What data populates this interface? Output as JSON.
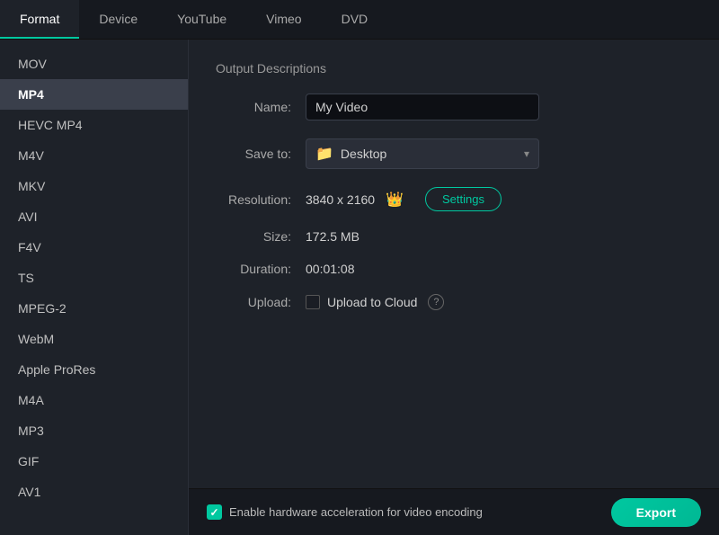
{
  "tabs": [
    {
      "id": "format",
      "label": "Format",
      "active": true
    },
    {
      "id": "device",
      "label": "Device",
      "active": false
    },
    {
      "id": "youtube",
      "label": "YouTube",
      "active": false
    },
    {
      "id": "vimeo",
      "label": "Vimeo",
      "active": false
    },
    {
      "id": "dvd",
      "label": "DVD",
      "active": false
    }
  ],
  "sidebar": {
    "items": [
      {
        "id": "mov",
        "label": "MOV",
        "selected": false
      },
      {
        "id": "mp4",
        "label": "MP4",
        "selected": true
      },
      {
        "id": "hevc-mp4",
        "label": "HEVC MP4",
        "selected": false
      },
      {
        "id": "m4v",
        "label": "M4V",
        "selected": false
      },
      {
        "id": "mkv",
        "label": "MKV",
        "selected": false
      },
      {
        "id": "avi",
        "label": "AVI",
        "selected": false
      },
      {
        "id": "f4v",
        "label": "F4V",
        "selected": false
      },
      {
        "id": "ts",
        "label": "TS",
        "selected": false
      },
      {
        "id": "mpeg2",
        "label": "MPEG-2",
        "selected": false
      },
      {
        "id": "webm",
        "label": "WebM",
        "selected": false
      },
      {
        "id": "apple-prores",
        "label": "Apple ProRes",
        "selected": false
      },
      {
        "id": "m4a",
        "label": "M4A",
        "selected": false
      },
      {
        "id": "mp3",
        "label": "MP3",
        "selected": false
      },
      {
        "id": "gif",
        "label": "GIF",
        "selected": false
      },
      {
        "id": "av1",
        "label": "AV1",
        "selected": false
      }
    ]
  },
  "output": {
    "section_title": "Output Descriptions",
    "name_label": "Name:",
    "name_value": "My Video",
    "name_placeholder": "My Video",
    "save_label": "Save to:",
    "save_folder_icon": "📁",
    "save_location": "Desktop",
    "resolution_label": "Resolution:",
    "resolution_value": "3840 x 2160",
    "crown_icon": "👑",
    "settings_label": "Settings",
    "size_label": "Size:",
    "size_value": "172.5 MB",
    "duration_label": "Duration:",
    "duration_value": "00:01:08",
    "upload_label": "Upload:",
    "upload_to_cloud_label": "Upload to Cloud",
    "upload_checked": false,
    "help_icon": "?",
    "chevron_down": "▾"
  },
  "bottom": {
    "hw_accel_label": "Enable hardware acceleration for video encoding",
    "hw_accel_checked": true,
    "export_label": "Export"
  }
}
